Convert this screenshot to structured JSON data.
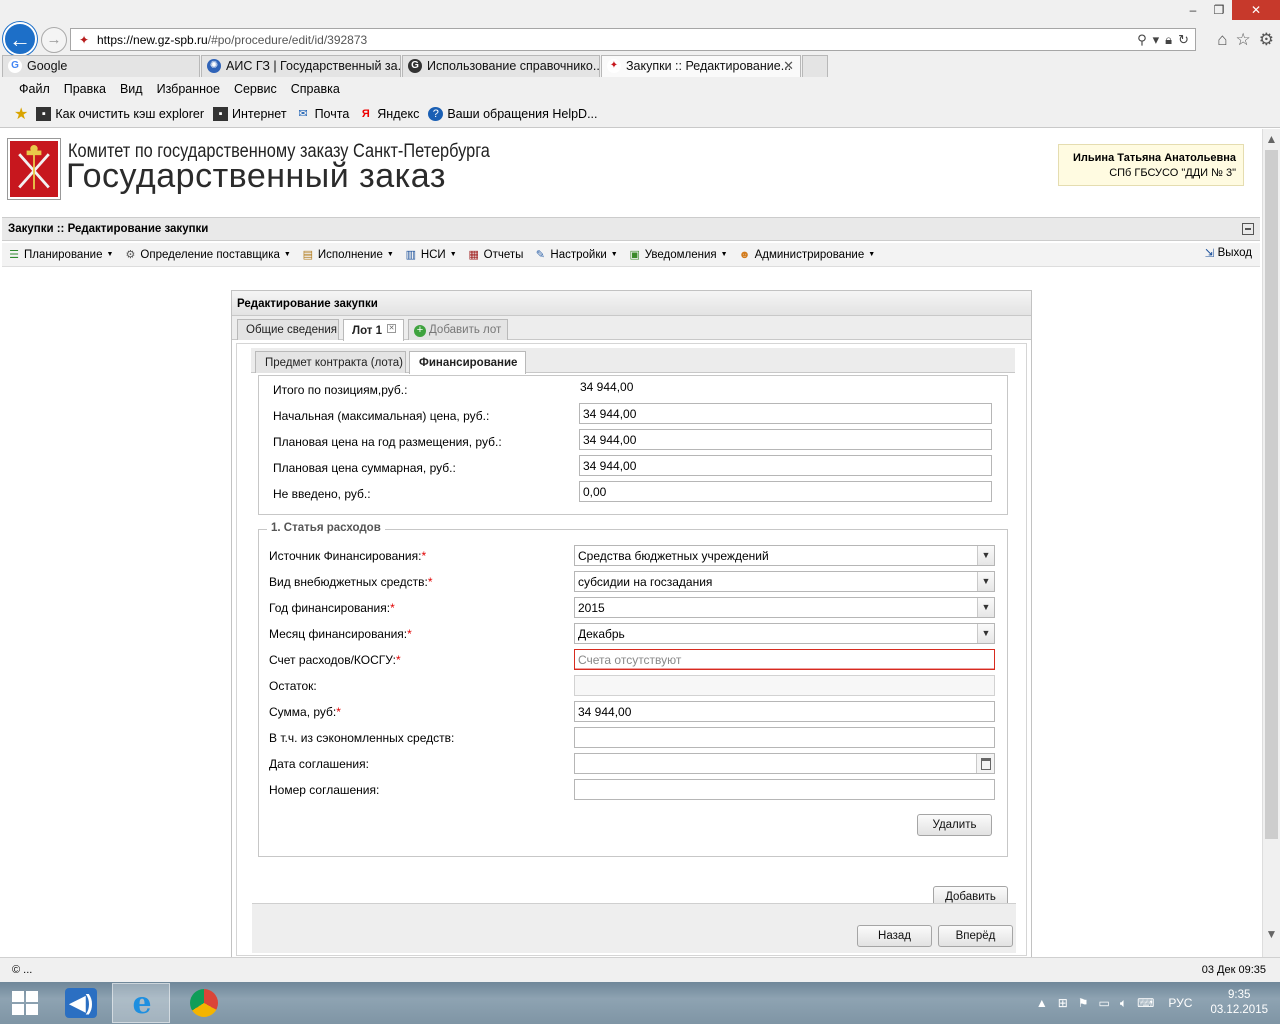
{
  "browser": {
    "url_host": "https://new.gz-spb.ru",
    "url_rest": "/#po/procedure/edit/id/392873",
    "tabs": [
      {
        "label": "Google",
        "active": false
      },
      {
        "label": "АИС ГЗ | Государственный за...",
        "active": false
      },
      {
        "label": "Использование справочнико...",
        "active": false
      },
      {
        "label": "Закупки :: Редактирование...",
        "active": true
      }
    ],
    "menu": [
      "Файл",
      "Правка",
      "Вид",
      "Избранное",
      "Сервис",
      "Справка"
    ],
    "favorites": [
      {
        "label": "Как очистить кэш explorer",
        "icon": "page-icon"
      },
      {
        "label": "Интернет",
        "icon": "page-icon"
      },
      {
        "label": "Почта",
        "icon": "mail-icon"
      },
      {
        "label": "Яндекс",
        "icon": "yandex-icon"
      },
      {
        "label": "Ваши обращения HelpD...",
        "icon": "help-icon"
      }
    ]
  },
  "site": {
    "org_name": "Комитет по государственному заказу Санкт-Петербурга",
    "system_name": "Государственный заказ",
    "user_name": "Ильина Татьяна Анатольевна",
    "user_org": "СПб ГБСУСО \"ДДИ № 3\""
  },
  "module_title": "Закупки :: Редактирование закупки",
  "toolbar": {
    "items": [
      {
        "label": "Планирование",
        "dropdown": true,
        "icon": "planning-icon"
      },
      {
        "label": "Определение поставщика",
        "dropdown": true,
        "icon": "gears-icon"
      },
      {
        "label": "Исполнение",
        "dropdown": true,
        "icon": "execution-icon"
      },
      {
        "label": "НСИ",
        "dropdown": true,
        "icon": "book-icon"
      },
      {
        "label": "Отчеты",
        "dropdown": false,
        "icon": "report-icon"
      },
      {
        "label": "Настройки",
        "dropdown": true,
        "icon": "wrench-icon"
      },
      {
        "label": "Уведомления",
        "dropdown": true,
        "icon": "notification-icon"
      },
      {
        "label": "Администрирование",
        "dropdown": true,
        "icon": "user-icon"
      }
    ],
    "exit_label": "Выход"
  },
  "panel": {
    "title": "Редактирование закупки",
    "outer_tabs": {
      "general": "Общие сведения",
      "lot": "Лот 1",
      "add_lot": "Добавить лот"
    },
    "inner_tabs": {
      "subject": "Предмет контракта (лота)",
      "financing": "Финансирование"
    },
    "summary": {
      "total_label": "Итого по позициям,руб.:",
      "total_value": "34 944,00",
      "initial_price_label": "Начальная (максимальная) цена, руб.:",
      "initial_price_value": "34 944,00",
      "planned_year_label": "Плановая цена на год размещения, руб.:",
      "planned_year_value": "34 944,00",
      "planned_total_label": "Плановая цена суммарная, руб.:",
      "planned_total_value": "34 944,00",
      "not_entered_label": "Не введено, руб.:",
      "not_entered_value": "0,00"
    },
    "expense": {
      "legend": "1. Статья расходов",
      "source_label": "Источник Финансирования:",
      "source_value": "Средства бюджетных учреждений",
      "extra_funds_label": "Вид внебюджетных средств:",
      "extra_funds_value": "субсидии на госзадания",
      "year_label": "Год финансирования:",
      "year_value": "2015",
      "month_label": "Месяц финансирования:",
      "month_value": "Декабрь",
      "account_label": "Счет расходов/КОСГУ:",
      "account_placeholder": "Счета отсутствуют",
      "remainder_label": "Остаток:",
      "remainder_value": "",
      "sum_label": "Сумма, руб:",
      "sum_value": "34 944,00",
      "saved_label": "В т.ч. из сэкономленных средств:",
      "saved_value": "",
      "agreement_date_label": "Дата соглашения:",
      "agreement_date_value": "",
      "agreement_number_label": "Номер соглашения:",
      "agreement_number_value": "",
      "delete_label": "Удалить"
    },
    "add_label": "Добавить",
    "back_label": "Назад",
    "next_label": "Вперёд"
  },
  "status": {
    "left": "© ...",
    "right": "03 Дек 09:35"
  },
  "taskbar": {
    "language": "РУС",
    "time": "9:35",
    "date": "03.12.2015"
  },
  "colors": {
    "accent_blue": "#1d6fc8",
    "required_red": "#e00000",
    "invalid_border": "#d72b1f",
    "user_box_bg": "#fffbe1"
  }
}
